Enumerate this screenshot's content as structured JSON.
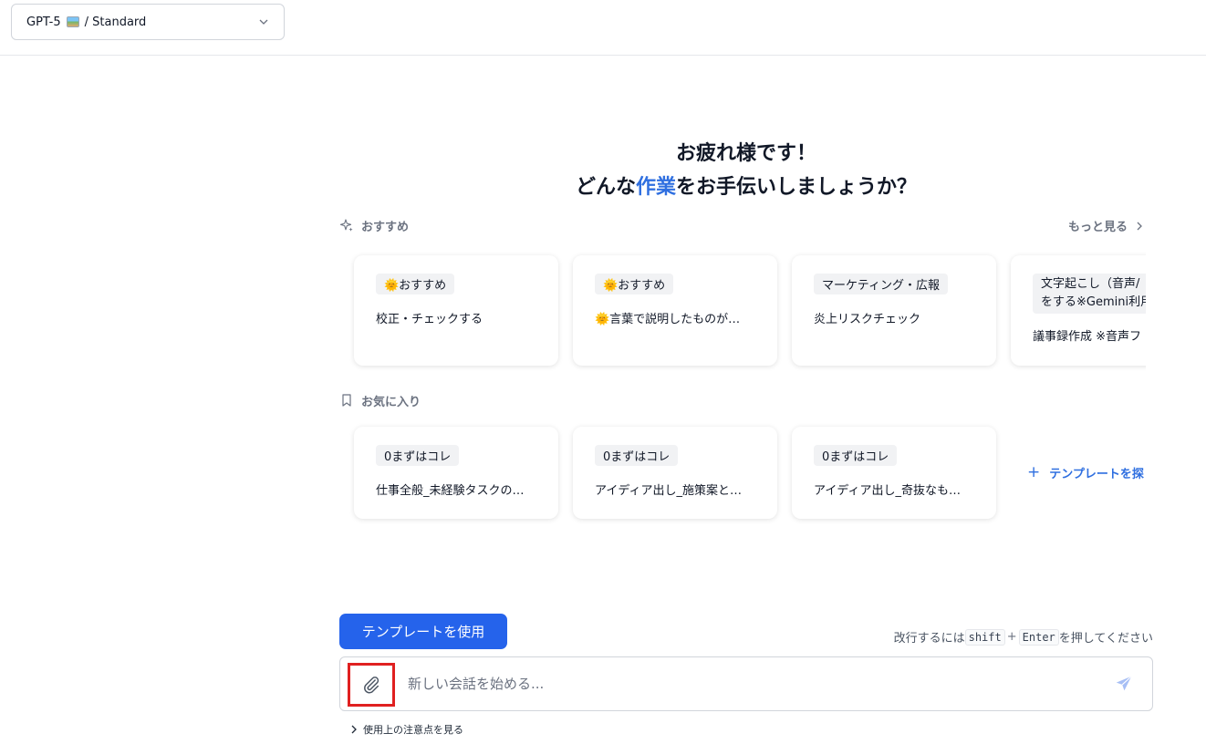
{
  "header": {
    "model_name": "GPT-5",
    "model_image_icon": "framed-picture-emoji",
    "model_suffix": "/ Standard"
  },
  "greeting": {
    "line1": "お疲れ様です！",
    "line2_before": "どんな",
    "line2_accent": "作業",
    "line2_after": "をお手伝いしましょうか？",
    "accent_color": "#2f6fe0"
  },
  "recommended": {
    "heading": "おすすめ",
    "more_label": "もっと見る",
    "cards": [
      {
        "badge": "🌞おすすめ",
        "title": "校正・チェックする"
      },
      {
        "badge": "🌞おすすめ",
        "title": "🌞言葉で説明したものが…"
      },
      {
        "badge": "マーケティング・広報",
        "title": "炎上リスクチェック"
      },
      {
        "badge": "文字起こし（音声/",
        "badge_line2": "をする※Gemini利用",
        "title": "議事録作成 ※音声フ"
      }
    ]
  },
  "favorites": {
    "heading": "お気に入り",
    "cards": [
      {
        "badge": "0まずはコレ",
        "title": "仕事全般_未経験タスクの…"
      },
      {
        "badge": "0まずはコレ",
        "title": "アイディア出し_施策案と…"
      },
      {
        "badge": "0まずはコレ",
        "title": "アイディア出し_奇抜なも…"
      }
    ],
    "add_template_label": "テンプレートを探"
  },
  "composer": {
    "use_template_label": "テンプレートを使用",
    "hint_before": "改行するには",
    "hint_key1": "shift",
    "hint_plus": "+",
    "hint_key2": "Enter",
    "hint_after": "を押してください",
    "placeholder": "新しい会話を始める...",
    "value": ""
  },
  "footer": {
    "notes_label": "使用上の注意点を見る"
  },
  "colors": {
    "primary": "#2563eb",
    "highlight_box": "#e02020"
  }
}
